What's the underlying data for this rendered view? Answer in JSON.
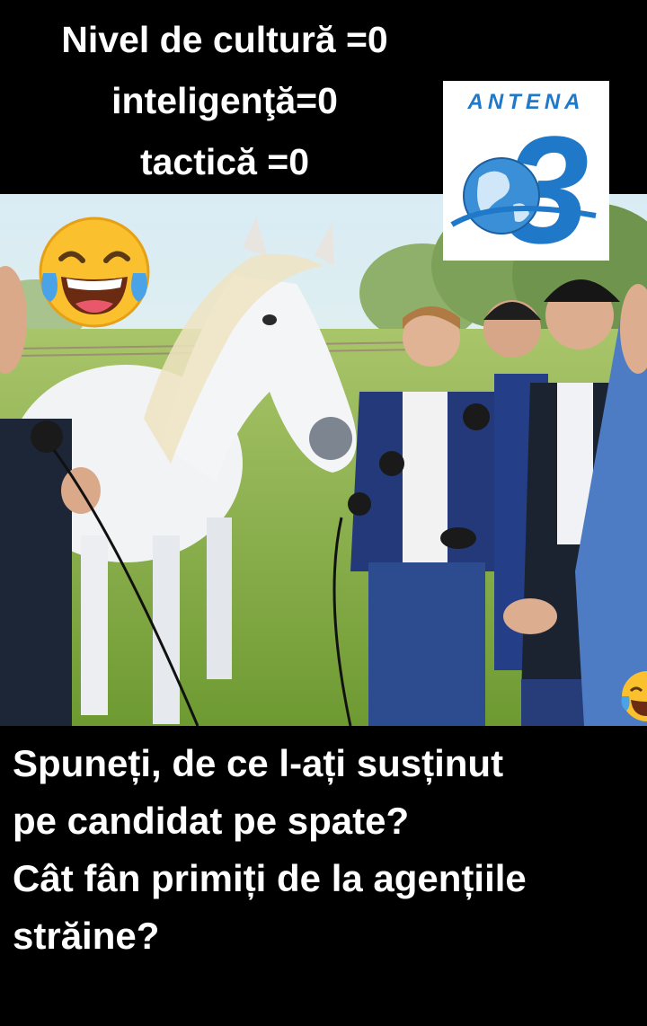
{
  "header": {
    "line1": "Nivel de cultură =0",
    "line2": "inteligenţă=0",
    "line3": "tactică =0"
  },
  "logo": {
    "name": "ANTENA",
    "number": "3",
    "icon": "globe-icon",
    "color": "#1f78c8"
  },
  "caption": {
    "line1": "Spuneți, de ce l-ați susținut",
    "line2": "pe candidat pe spate?",
    "line3": "Cât fân primiți de la agențiile",
    "line4": "străine?"
  },
  "emojis": [
    "laughing-tears-emoji",
    "laughing-tears-emoji"
  ],
  "colors": {
    "background": "#000000",
    "text": "#ffffff",
    "sky": "#cfe4ef",
    "grass": "#7fa93f"
  }
}
